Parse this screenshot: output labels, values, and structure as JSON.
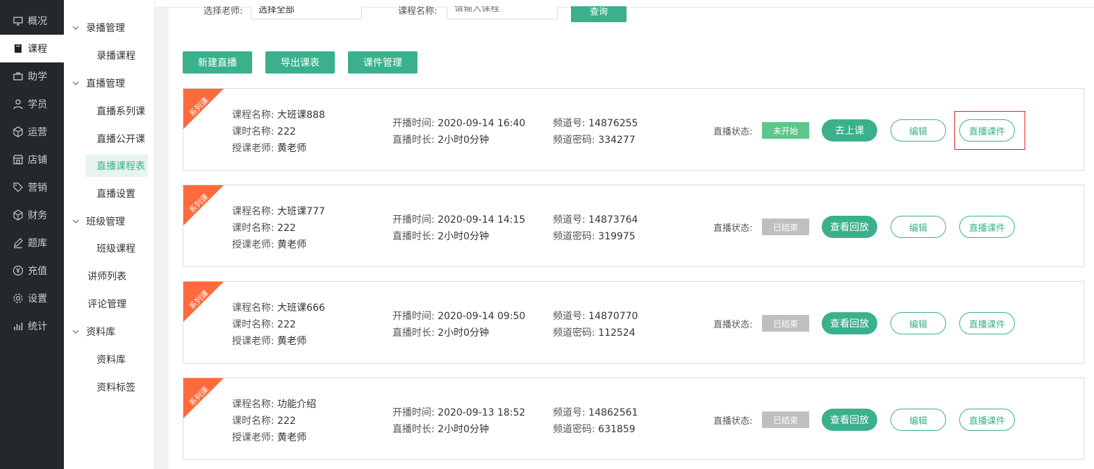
{
  "nav": [
    {
      "label": "概况",
      "icon": "monitor-icon"
    },
    {
      "label": "课程",
      "icon": "book-icon"
    },
    {
      "label": "助学",
      "icon": "briefcase-icon"
    },
    {
      "label": "学员",
      "icon": "user-icon"
    },
    {
      "label": "运营",
      "icon": "cube-icon"
    },
    {
      "label": "店铺",
      "icon": "store-icon"
    },
    {
      "label": "营销",
      "icon": "tag-icon"
    },
    {
      "label": "财务",
      "icon": "box-icon"
    },
    {
      "label": "题库",
      "icon": "pen-icon"
    },
    {
      "label": "充值",
      "icon": "yen-icon"
    },
    {
      "label": "设置",
      "icon": "gear-icon"
    },
    {
      "label": "统计",
      "icon": "bar-chart-icon"
    }
  ],
  "subnav": {
    "group_recorded": "录播管理",
    "recorded_courses": "录播课程",
    "group_live": "直播管理",
    "live_series": "直播系列课",
    "live_open": "直播公开课",
    "live_schedule": "直播课程表",
    "live_settings": "直播设置",
    "group_class": "班级管理",
    "class_courses": "班级课程",
    "lecturers": "讲师列表",
    "comments": "评论管理",
    "group_materials": "资料库",
    "materials": "资料库",
    "material_tags": "资料标签"
  },
  "filter": {
    "teacher_label": "选择老师:",
    "teacher_value": "选择全部",
    "course_label": "课程名称:",
    "course_placeholder": "请输入课程",
    "search_button": "查询"
  },
  "toolbar": {
    "new_live": "新建直播",
    "export": "导出课表",
    "courseware": "课件管理"
  },
  "labels": {
    "ribbon": "系列课",
    "course_name": "课程名称:",
    "lesson_name": "课时名称:",
    "teacher": "授课老师:",
    "start_time": "开播时间:",
    "duration": "直播时长:",
    "channel": "频道号:",
    "channel_pwd": "频道密码:",
    "status": "直播状态:",
    "edit": "编辑",
    "courseware": "直播课件"
  },
  "colors": {
    "accent": "#3ab08c",
    "ribbon": "#ff6a3d",
    "status_pending": "#5cc78c",
    "status_ended": "#bfbfbf"
  },
  "lessons": [
    {
      "course": "大班课888",
      "lesson": "222",
      "teacher": "黄老师",
      "start": "2020-09-14 16:40",
      "duration": "2小时0分钟",
      "channel": "14876255",
      "pwd": "334277",
      "status": "未开始",
      "action": "去上课"
    },
    {
      "course": "大班课777",
      "lesson": "222",
      "teacher": "黄老师",
      "start": "2020-09-14 14:15",
      "duration": "2小时0分钟",
      "channel": "14873764",
      "pwd": "319975",
      "status": "已结束",
      "action": "查看回放"
    },
    {
      "course": "大班课666",
      "lesson": "222",
      "teacher": "黄老师",
      "start": "2020-09-14 09:50",
      "duration": "2小时0分钟",
      "channel": "14870770",
      "pwd": "112524",
      "status": "已结束",
      "action": "查看回放"
    },
    {
      "course": "功能介绍",
      "lesson": "222",
      "teacher": "黄老师",
      "start": "2020-09-13 18:52",
      "duration": "2小时0分钟",
      "channel": "14862561",
      "pwd": "631859",
      "status": "已结束",
      "action": "查看回放"
    }
  ]
}
